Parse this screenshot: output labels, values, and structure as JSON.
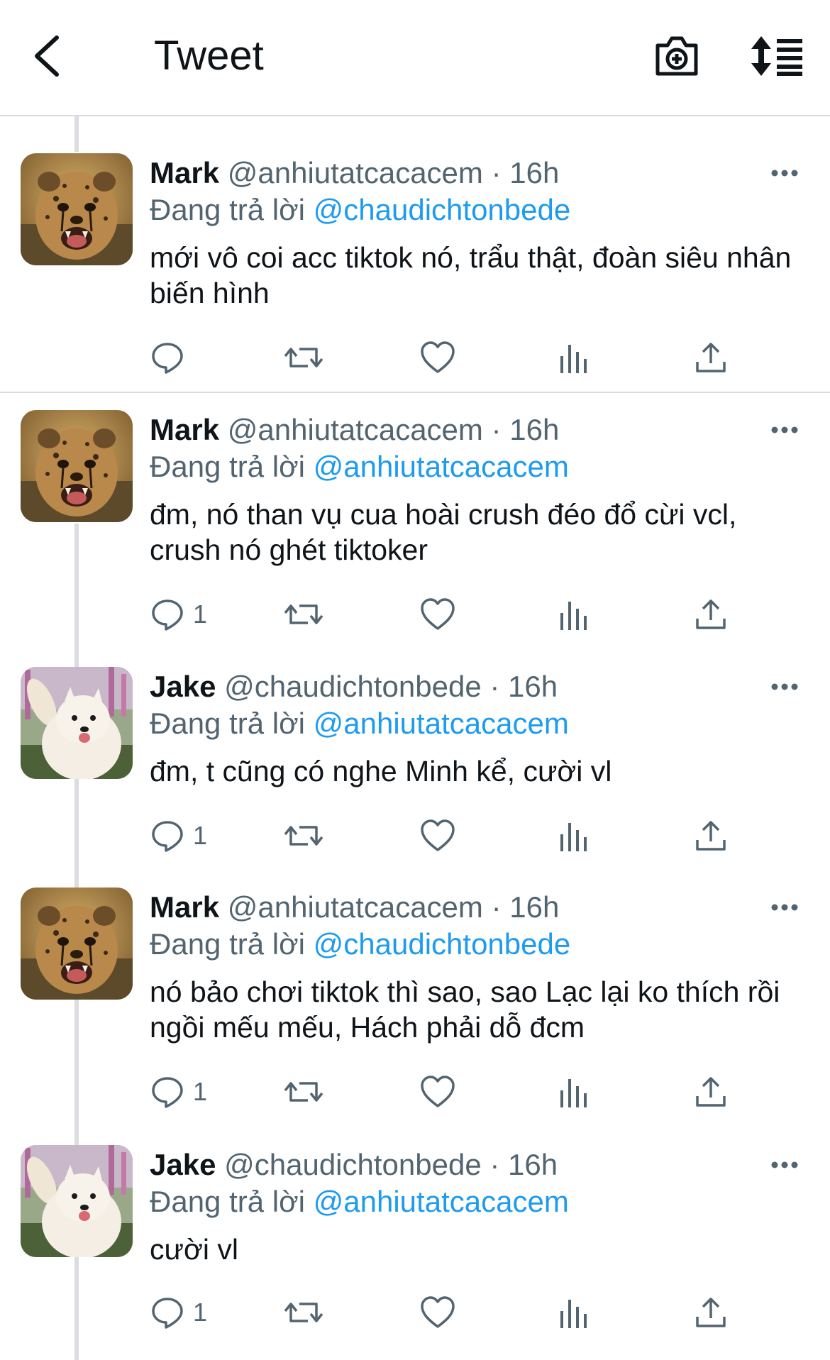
{
  "header": {
    "title": "Tweet",
    "back_icon": "chevron-left-icon",
    "camera_icon": "camera-plus-icon",
    "sort_icon": "sort-list-icon"
  },
  "colors": {
    "text": "#0f1419",
    "muted": "#536471",
    "link": "#1d9bf0",
    "divider": "#dcdcdc"
  },
  "tweets": [
    {
      "name": "Mark",
      "handle": "@anhiutatcacacem",
      "dot": "·",
      "time": "16h",
      "reply_prefix": "Đang trả lời",
      "reply_to": "@chaudichtonbede",
      "text": "mới vô coi acc tiktok nó, trẩu thật, đoàn siêu nhân biến hình",
      "reply_count": "",
      "avatar": "cheetah-avatar"
    },
    {
      "name": "Mark",
      "handle": "@anhiutatcacacem",
      "dot": "·",
      "time": "16h",
      "reply_prefix": "Đang trả lời",
      "reply_to": "@anhiutatcacacem",
      "text": "đm, nó than vụ cua hoài crush đéo đổ cừi vcl, crush nó ghét tiktoker",
      "reply_count": "1",
      "avatar": "cheetah-avatar"
    },
    {
      "name": "Jake",
      "handle": "@chaudichtonbede",
      "dot": "·",
      "time": "16h",
      "reply_prefix": "Đang trả lời",
      "reply_to": "@anhiutatcacacem",
      "text": "đm, t cũng có nghe Minh kể, cười vl",
      "reply_count": "1",
      "avatar": "samoyed-avatar"
    },
    {
      "name": "Mark",
      "handle": "@anhiutatcacacem",
      "dot": "·",
      "time": "16h",
      "reply_prefix": "Đang trả lời",
      "reply_to": "@chaudichtonbede",
      "text": "nó bảo chơi tiktok thì sao, sao Lạc lại ko thích rồi ngồi mếu mếu, Hách phải dỗ đcm",
      "reply_count": "1",
      "avatar": "cheetah-avatar"
    },
    {
      "name": "Jake",
      "handle": "@chaudichtonbede",
      "dot": "·",
      "time": "16h",
      "reply_prefix": "Đang trả lời",
      "reply_to": "@anhiutatcacacem",
      "text": "cười vl",
      "reply_count": "1",
      "avatar": "samoyed-avatar"
    }
  ]
}
